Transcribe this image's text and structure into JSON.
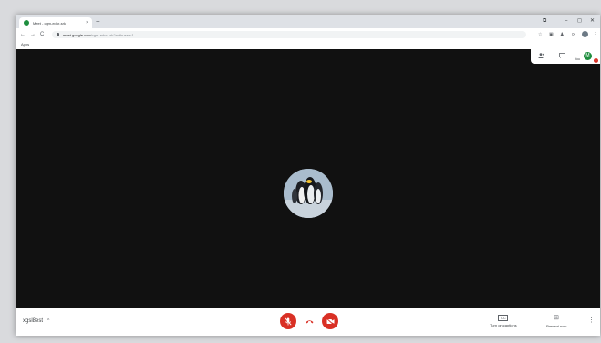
{
  "browser": {
    "tab_title": "Meet - cgm-edur-srk",
    "tab_close": "×",
    "new_tab": "+",
    "window_controls": {
      "restore_menu": "⧉",
      "minimize": "–",
      "maximize": "◻",
      "close": "✕"
    },
    "nav": {
      "back": "←",
      "forward": "→",
      "reload": "C"
    },
    "url_host": "meet.google.com",
    "url_path": "/cgm-edur-srk?authuser=1",
    "toolbar_icons": {
      "star": "☆",
      "extensions": "▣",
      "account": "♟",
      "cast": "⊳",
      "menu": "⋮"
    },
    "bookmark_apps": "Apps"
  },
  "meeting": {
    "panel": {
      "people_icon": "👥",
      "chat_icon": "▤",
      "you_initial": "M",
      "you_label": "You",
      "badge_count": "1"
    },
    "participant_avatar": "penguins"
  },
  "bottom_bar": {
    "meeting_code": "xgsl8est",
    "chevron": "^",
    "controls": {
      "mic": "mic-off",
      "hangup": "call-end",
      "camera": "video-off"
    },
    "captions_icon": "CC",
    "captions_label": "Turn on captions",
    "present_icon": "⊞",
    "present_label": "Present now",
    "more": "⋮"
  },
  "colors": {
    "accent_red": "#d93025",
    "meeting_bg": "#111111",
    "you_avatar": "#1e8e3e"
  }
}
